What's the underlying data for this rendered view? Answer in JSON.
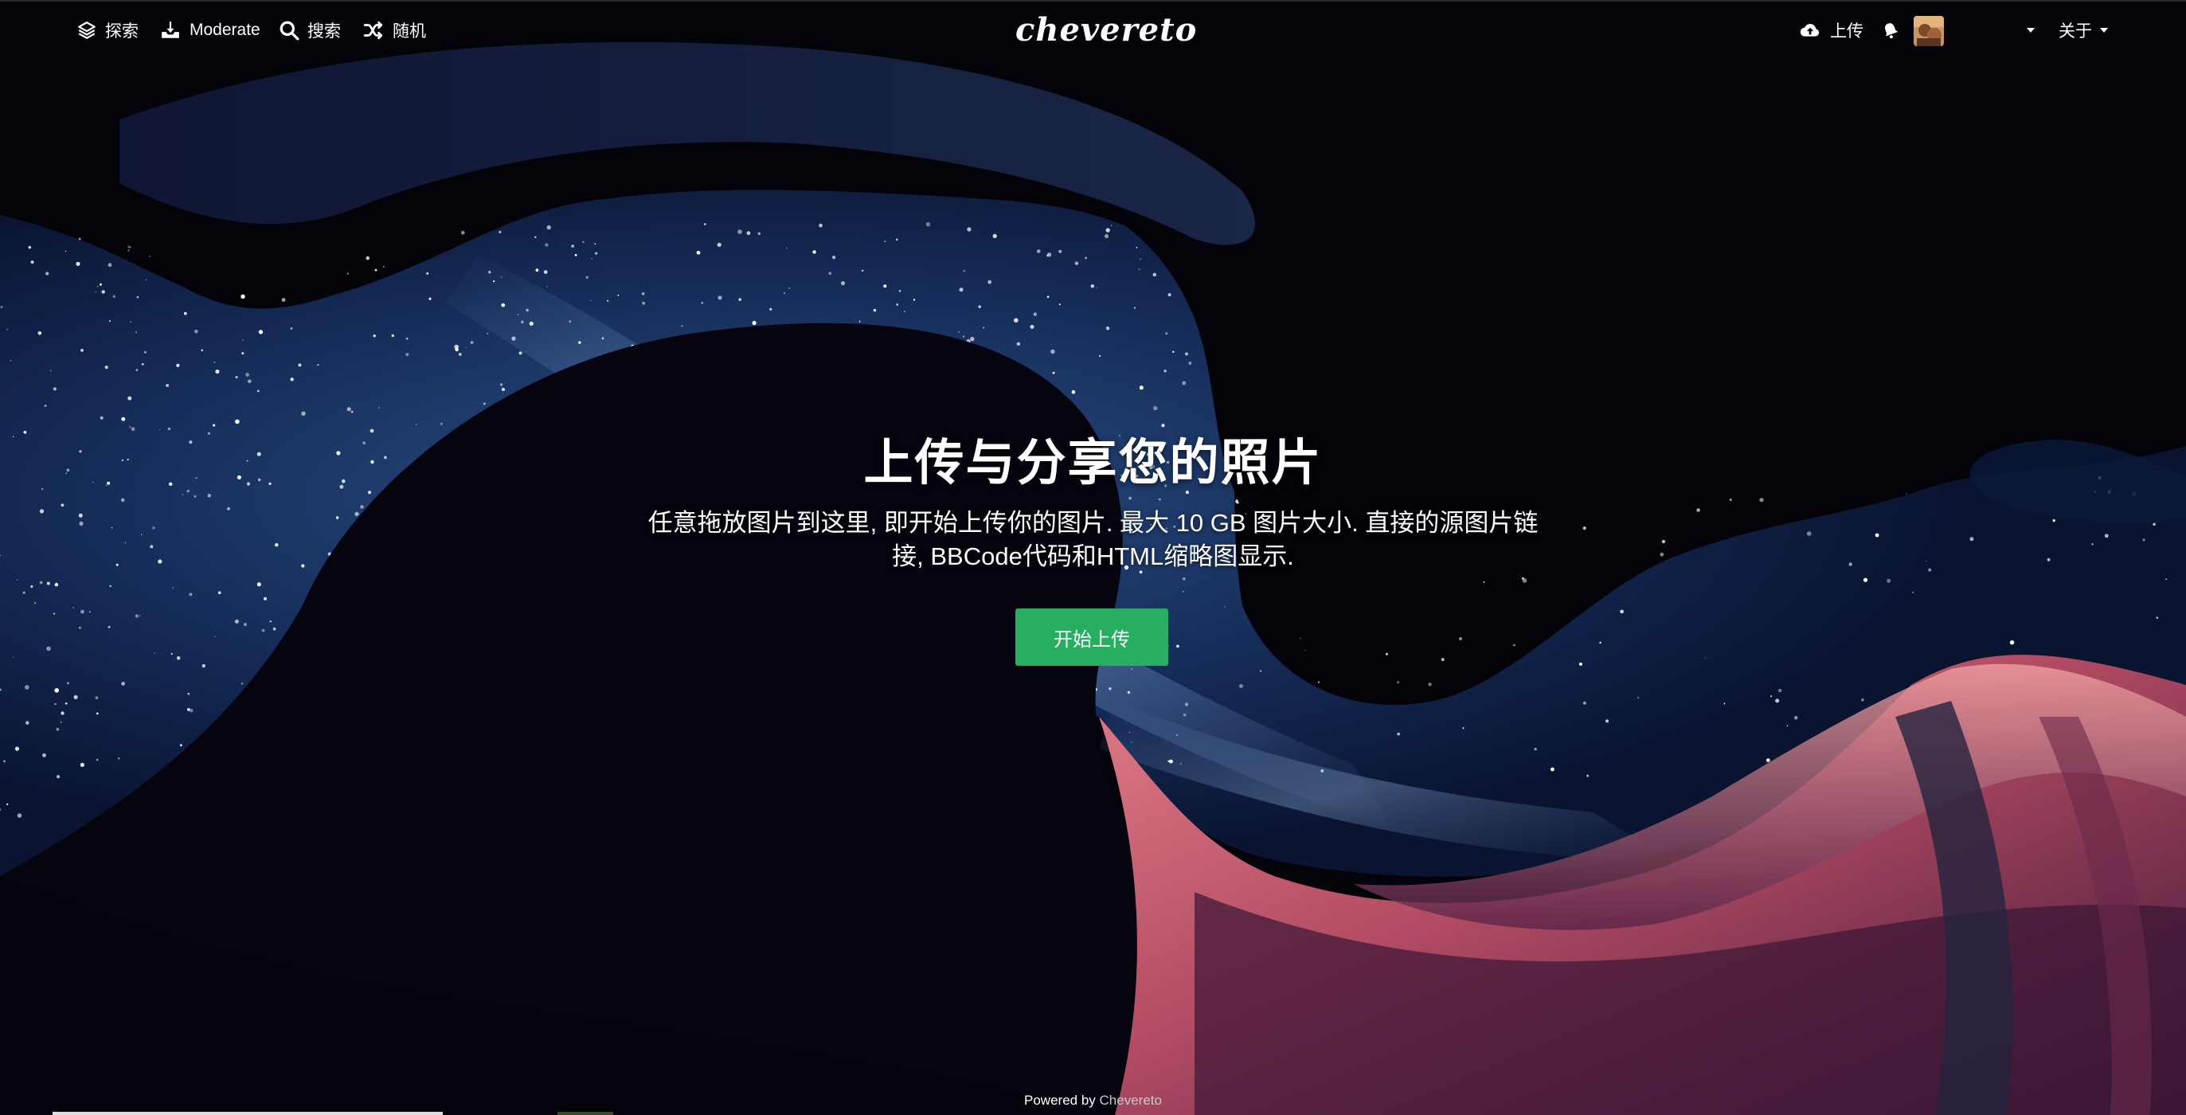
{
  "nav": {
    "explore_label": "探索",
    "moderate_label": "Moderate",
    "search_label": "搜索",
    "random_label": "随机",
    "upload_label": "上传",
    "about_label": "关于"
  },
  "logo_text": "chevereto",
  "hero": {
    "title": "上传与分享您的照片",
    "description": "任意拖放图片到这里, 即开始上传你的图片. 最大 10 GB 图片大小. 直接的源图片链接, BBCode代码和HTML缩略图显示.",
    "start_button": "开始上传"
  },
  "footer": {
    "powered_prefix": "Powered by",
    "powered_link": "Chevereto"
  },
  "colors": {
    "accent_green": "#27ae60",
    "background": "#05040c"
  },
  "icons": [
    "layers-icon",
    "inbox-download-icon",
    "search-icon",
    "shuffle-icon",
    "cloud-upload-icon",
    "notification-bell-icon",
    "caret-down-icon"
  ]
}
